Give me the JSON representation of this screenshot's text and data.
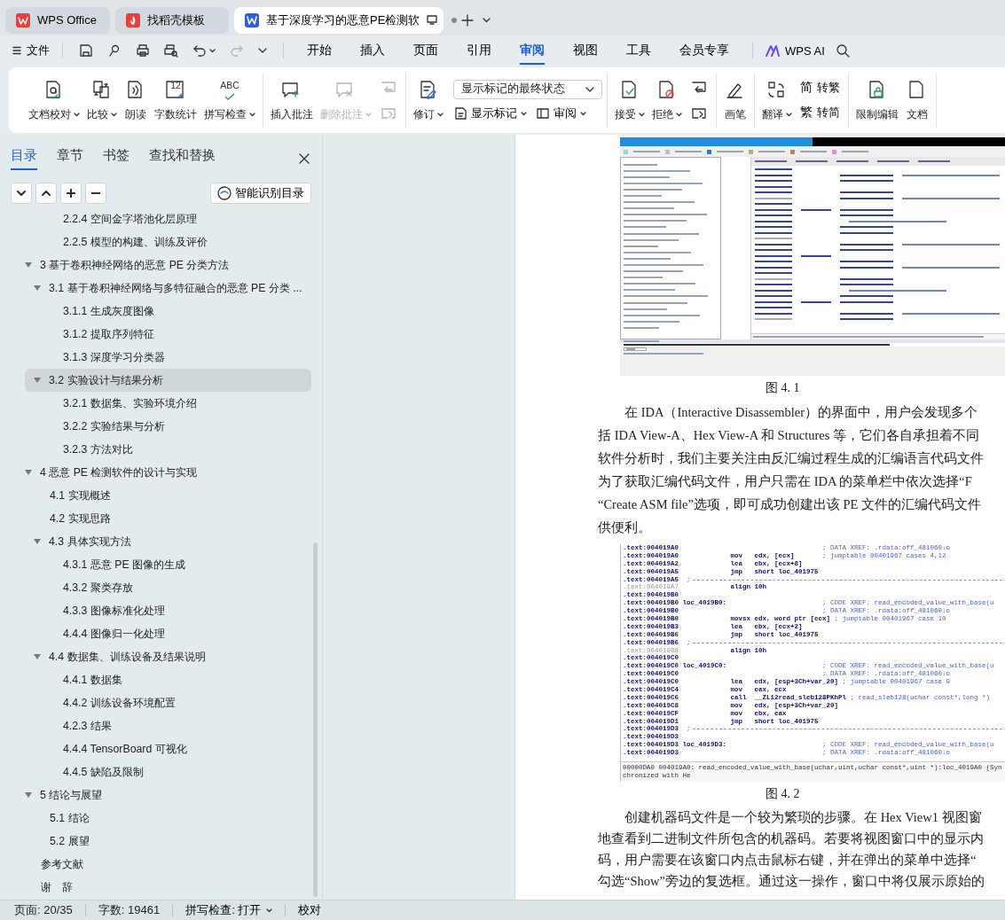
{
  "app_tabs": [
    {
      "label": "WPS Office",
      "kind": "home",
      "selected": false
    },
    {
      "label": "找稻壳模板",
      "kind": "template",
      "selected": false
    },
    {
      "label": "基于深度学习的恶意PE检测软",
      "kind": "document",
      "selected": true
    }
  ],
  "menu": {
    "file": "文件",
    "tabs": [
      {
        "label": "开始",
        "selected": false
      },
      {
        "label": "插入",
        "selected": false
      },
      {
        "label": "页面",
        "selected": false
      },
      {
        "label": "引用",
        "selected": false
      },
      {
        "label": "审阅",
        "selected": true
      },
      {
        "label": "视图",
        "selected": false
      },
      {
        "label": "工具",
        "selected": false
      },
      {
        "label": "会员专享",
        "selected": false
      }
    ],
    "ai": "WPS AI"
  },
  "ribbon": {
    "groups": [
      {
        "items": [
          {
            "kind": "large",
            "label": "文档校对",
            "dropdown": true,
            "disabled": false
          },
          {
            "kind": "large",
            "label": "比较",
            "dropdown": true,
            "disabled": false
          },
          {
            "kind": "large",
            "label": "朗读",
            "dropdown": false,
            "disabled": false
          },
          {
            "kind": "large",
            "label": "字数统计",
            "icon_text": "12",
            "dropdown": false,
            "disabled": false
          },
          {
            "kind": "large",
            "label": "拼写检查",
            "icon_text": "ABC",
            "dropdown": true,
            "disabled": false
          }
        ]
      },
      {
        "items": [
          {
            "kind": "large",
            "label": "插入批注",
            "dropdown": false,
            "disabled": false
          },
          {
            "kind": "large",
            "label": "删除批注",
            "dropdown": true,
            "disabled": true
          },
          {
            "kind": "small_stack",
            "disabled": true
          }
        ]
      },
      {
        "items": [
          {
            "kind": "large",
            "label": "修订",
            "dropdown": true,
            "disabled": false
          },
          {
            "kind": "review_pane",
            "select": "显示标记的最终状态",
            "buttons": [
              "显示标记",
              "审阅"
            ]
          }
        ]
      },
      {
        "items": [
          {
            "kind": "large",
            "label": "接受",
            "dropdown": true,
            "disabled": false
          },
          {
            "kind": "large",
            "label": "拒绝",
            "dropdown": true,
            "disabled": false
          },
          {
            "kind": "small_stack",
            "disabled": false
          }
        ]
      },
      {
        "items": [
          {
            "kind": "large",
            "label": "画笔",
            "dropdown": false,
            "disabled": false
          }
        ]
      },
      {
        "items": [
          {
            "kind": "large",
            "label": "翻译",
            "dropdown": true,
            "disabled": false
          },
          {
            "kind": "convert_stack",
            "rows": [
              {
                "glyph": "简",
                "label": "转繁"
              },
              {
                "glyph": "繁",
                "label": "转简"
              }
            ]
          }
        ]
      },
      {
        "items": [
          {
            "kind": "large",
            "label": "限制编辑",
            "dropdown": false,
            "disabled": false
          },
          {
            "kind": "large",
            "label": "文档",
            "dropdown": false,
            "disabled": false
          }
        ]
      }
    ]
  },
  "nav": {
    "tabs": [
      {
        "label": "目录",
        "selected": true
      },
      {
        "label": "章节",
        "selected": false
      },
      {
        "label": "书签",
        "selected": false
      },
      {
        "label": "查找和替换",
        "selected": false
      }
    ],
    "smart_toc": "智能识别目录",
    "toc": {
      "continued": [
        {
          "label": "2.2.4  空间金字塔池化层原理",
          "selected": false
        },
        {
          "label": "2.2.5  模型的构建、训练及评价",
          "selected": false
        }
      ],
      "items": [
        {
          "label": "3  基于卷积神经网络的恶意 PE 分类方法",
          "selected": false,
          "expanded": true,
          "children": [
            {
              "label": "3.1  基于卷积神经网络与多特征融合的恶意 PE 分类 ...",
              "selected": false,
              "expanded": true,
              "children": [
                {
                  "label": "3.1.1  生成灰度图像",
                  "selected": false
                },
                {
                  "label": "3.1.2  提取序列特征",
                  "selected": false
                },
                {
                  "label": "3.1.3  深度学习分类器",
                  "selected": false
                }
              ]
            },
            {
              "label": "3.2  实验设计与结果分析",
              "selected": true,
              "expanded": true,
              "children": [
                {
                  "label": "3.2.1  数据集、实验环境介绍",
                  "selected": false
                },
                {
                  "label": "3.2.2  实验结果与分析",
                  "selected": false
                },
                {
                  "label": "3.2.3  方法对比",
                  "selected": false
                }
              ]
            }
          ]
        },
        {
          "label": "4  恶意 PE 检测软件的设计与实现",
          "selected": false,
          "expanded": true,
          "children": [
            {
              "label": "4.1  实现概述",
              "selected": false
            },
            {
              "label": "4.2  实现思路",
              "selected": false
            },
            {
              "label": "4.3 具体实现方法",
              "selected": false,
              "expanded": true,
              "children": [
                {
                  "label": "4.3.1 恶意 PE 图像的生成",
                  "selected": false
                },
                {
                  "label": "4.3.2 聚类存放",
                  "selected": false
                },
                {
                  "label": "4.3.3 图像标准化处理",
                  "selected": false
                },
                {
                  "label": "4.4.4 图像归一化处理",
                  "selected": false
                }
              ]
            },
            {
              "label": "4.4 数据集、训练设备及结果说明",
              "selected": false,
              "expanded": true,
              "children": [
                {
                  "label": "4.4.1 数据集",
                  "selected": false
                },
                {
                  "label": "4.4.2 训练设备环境配置",
                  "selected": false
                },
                {
                  "label": "4.2.3  结果",
                  "selected": false
                },
                {
                  "label": "4.4.4 TensorBoard 可视化",
                  "selected": false
                },
                {
                  "label": "4.4.5  缺陷及限制",
                  "selected": false
                }
              ]
            }
          ]
        },
        {
          "label": "5  结论与展望",
          "selected": false,
          "expanded": true,
          "children": [
            {
              "label": "5.1  结论",
              "selected": false
            },
            {
              "label": "5.2  展望",
              "selected": false
            }
          ]
        },
        {
          "label": "参考文献",
          "selected": false
        },
        {
          "label": "谢　辞",
          "selected": false
        }
      ]
    }
  },
  "document": {
    "blocks": [
      {
        "kind": "ida_window"
      },
      {
        "kind": "caption",
        "text": "图 4. 1"
      },
      {
        "kind": "paragraph",
        "lines": [
          "在 IDA（Interactive Disassembler）的界面中，用户会发现多个",
          "括 IDA View-A、Hex View-A 和 Structures 等，它们各自承担着不同",
          "软件分析时，我们主要关注由反汇编过程生成的汇编语言代码文件",
          "为了获取汇编代码文件，用户只需在 IDA 的菜单栏中依次选择“F",
          "“Create ASM file”选项，即可成功创建出该 PE 文件的汇编代码文件",
          "供便利。"
        ]
      },
      {
        "kind": "code_listing",
        "code_lines": [
          {
            "kind": "code",
            "addr": ".text:004019A0",
            "comment": "; DATA XREF: .rdata:off_481060↓o"
          },
          {
            "kind": "code",
            "addr": ".text:004019A0",
            "op": "mov",
            "args": "edx, [ecx]",
            "comment": "; jumptable 00401967 cases 4,12"
          },
          {
            "kind": "code",
            "addr": ".text:004019A2",
            "op": "lea",
            "args": "ebx, [ecx+8]"
          },
          {
            "kind": "code",
            "addr": ".text:004019A5",
            "op": "jmp",
            "args": "short loc_401975"
          },
          {
            "kind": "separator",
            "addr": ".text:004019A5",
            "comment": ";"
          },
          {
            "kind": "gray",
            "addr": ".text:004019A7",
            "op": "align 10h"
          },
          {
            "kind": "code",
            "addr": ".text:004019B0"
          },
          {
            "kind": "code",
            "addr": ".text:004019B0",
            "label": "loc_4019B0:",
            "comment": "; CODE XREF: read_encoded_value_with_base(u"
          },
          {
            "kind": "code",
            "addr": ".text:004019B0",
            "comment": "; DATA XREF: .rdata:off_481060↓o"
          },
          {
            "kind": "code",
            "addr": ".text:004019B0",
            "op": "movsx",
            "args": "edx, word ptr [ecx]",
            "comment": "; jumptable 00401967 case 10"
          },
          {
            "kind": "code",
            "addr": ".text:004019B3",
            "op": "lea",
            "args": "ebx, [ecx+2]"
          },
          {
            "kind": "code",
            "addr": ".text:004019B6",
            "op": "jmp",
            "args": "short loc_401975"
          },
          {
            "kind": "separator",
            "addr": ".text:004019B6",
            "comment": ";"
          },
          {
            "kind": "gray",
            "addr": ".text:004019B8",
            "op": "align 10h"
          },
          {
            "kind": "code",
            "addr": ".text:004019C0"
          },
          {
            "kind": "code",
            "addr": ".text:004019C0",
            "label": "loc_4019C0:",
            "comment": "; CODE XREF: read_encoded_value_with_base(u"
          },
          {
            "kind": "code",
            "addr": ".text:004019C0",
            "comment": "; DATA XREF: .rdata:off_481060↓o"
          },
          {
            "kind": "code",
            "addr": ".text:004019C0",
            "op": "lea",
            "args": "edx, [esp+3Ch+var_20]",
            "comment": "; jumptable 00401967 case 9"
          },
          {
            "kind": "code",
            "addr": ".text:004019C4",
            "op": "mov",
            "args": "eax, ecx"
          },
          {
            "kind": "code",
            "addr": ".text:004019C6",
            "op": "call",
            "args": "__ZL12read_sleb128PKhPl",
            "comment": "; read_sleb128(uchar const*,long *)"
          },
          {
            "kind": "code",
            "addr": ".text:004019C8",
            "op": "mov",
            "args": "edx, [esp+3Ch+var_20]"
          },
          {
            "kind": "code",
            "addr": ".text:004019CF",
            "op": "mov",
            "args": "ebx, eax"
          },
          {
            "kind": "code",
            "addr": ".text:004019D1",
            "op": "jmp",
            "args": "short loc_401975"
          },
          {
            "kind": "separator",
            "addr": ".text:004019D3",
            "comment": ";"
          },
          {
            "kind": "code",
            "addr": ".text:004019D3"
          },
          {
            "kind": "code",
            "addr": ".text:004019D3",
            "label": "loc_4019D3:",
            "comment": "; CODE XREF: read_encoded_value_with_base(u"
          },
          {
            "kind": "code",
            "addr": ".text:004019D3",
            "comment": "; DATA XREF: .rdata:off_481060↓o"
          }
        ],
        "status": "00000DA0 004019A0: read_encoded_value_with_base(uchar,uint,uchar const*,uint *):loc_4019A0 (Synchronized with He"
      },
      {
        "kind": "caption",
        "text": "图 4. 2"
      },
      {
        "kind": "paragraph",
        "lines": [
          "创建机器码文件是一个较为繁琐的步骤。在 Hex View1 视图窗",
          "地查看到二进制文件所包含的机器码。若要将视图窗口中的显示内",
          "码，用户需要在该窗口内点击鼠标右键，并在弹出的菜单中选择“",
          "勾选“Show”旁边的复选框。通过这一操作，窗口中将仅展示原始的"
        ]
      }
    ]
  },
  "status_bar": {
    "page": "页面: 20/35",
    "words": "字数: 19461",
    "spell": "拼写检查: 打开",
    "proof": "校对"
  }
}
